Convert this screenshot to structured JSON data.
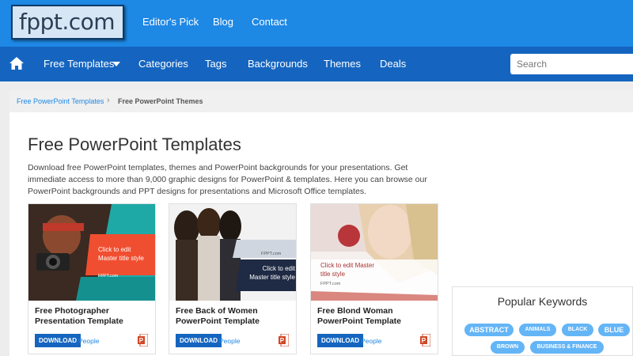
{
  "header": {
    "logo_text": "fppt.com",
    "top_links": [
      "Editor's Pick",
      "Blog",
      "Contact"
    ]
  },
  "nav": {
    "home_icon": "home-icon",
    "items": [
      "Free Templates",
      "Categories",
      "Tags",
      "Backgrounds",
      "Themes",
      "Deals"
    ],
    "search_placeholder": "Search"
  },
  "breadcrumb": {
    "link": "Free PowerPoint Templates",
    "separator": "›",
    "current": "Free PowerPoint Themes"
  },
  "main": {
    "title": "Free PowerPoint Templates",
    "intro": "Download free PowerPoint templates, themes and PowerPoint backgrounds for your presentations. Get immediate access to more than 9,000 graphic designs for PowerPoint & templates. Here you can browse our PowerPoint backgrounds and PPT designs for presentations and Microsoft Office templates."
  },
  "cards": [
    {
      "title": "Free Photographer Presentation Template",
      "download_label": "DOWNLOAD",
      "category": "People",
      "thumb_text": "Click to edit Master title style",
      "thumb_brand": "FPPT.com"
    },
    {
      "title": "Free Back of Women PowerPoint Template",
      "download_label": "DOWNLOAD",
      "category": "People",
      "thumb_text": "Click to edit Master title style",
      "thumb_brand": "FPPT.com"
    },
    {
      "title": "Free Blond Woman PowerPoint Template",
      "download_label": "DOWNLOAD",
      "category": "People",
      "thumb_text": "Click to edit Master title style",
      "thumb_brand": "FPPT.com"
    }
  ],
  "popular_keywords": {
    "title": "Popular Keywords",
    "tags": [
      "ABSTRACT",
      "ANIMALS",
      "BLACK",
      "BLUE",
      "BROWN",
      "BUSINESS & FINANCE"
    ]
  },
  "colors": {
    "topbar": "#1e88e5",
    "navbar": "#1565c0",
    "tag": "#64b5f6",
    "link": "#1e88e5"
  }
}
